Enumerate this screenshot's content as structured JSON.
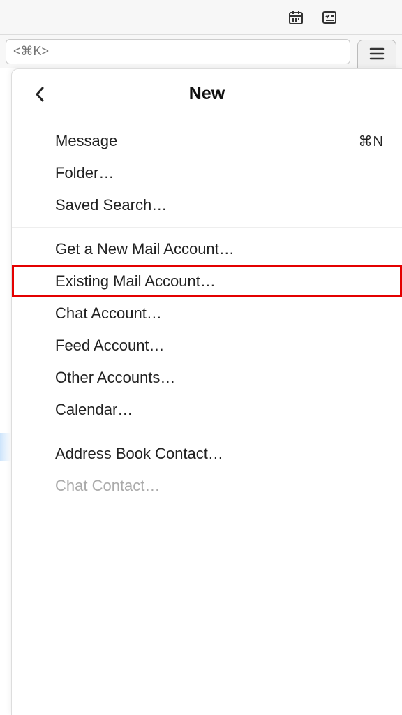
{
  "toolbar": {
    "calendar_icon": "calendar-icon",
    "tasks_icon": "tasks-icon"
  },
  "search": {
    "placeholder": "<⌘K>"
  },
  "menu": {
    "title": "New",
    "sections": [
      {
        "items": [
          {
            "label": "Message",
            "shortcut": "⌘N",
            "enabled": true,
            "highlighted": false
          },
          {
            "label": "Folder…",
            "shortcut": "",
            "enabled": true,
            "highlighted": false
          },
          {
            "label": "Saved Search…",
            "shortcut": "",
            "enabled": true,
            "highlighted": false
          }
        ]
      },
      {
        "items": [
          {
            "label": "Get a New Mail Account…",
            "shortcut": "",
            "enabled": true,
            "highlighted": false
          },
          {
            "label": "Existing Mail Account…",
            "shortcut": "",
            "enabled": true,
            "highlighted": true
          },
          {
            "label": "Chat Account…",
            "shortcut": "",
            "enabled": true,
            "highlighted": false
          },
          {
            "label": "Feed Account…",
            "shortcut": "",
            "enabled": true,
            "highlighted": false
          },
          {
            "label": "Other Accounts…",
            "shortcut": "",
            "enabled": true,
            "highlighted": false
          },
          {
            "label": "Calendar…",
            "shortcut": "",
            "enabled": true,
            "highlighted": false
          }
        ]
      },
      {
        "items": [
          {
            "label": "Address Book Contact…",
            "shortcut": "",
            "enabled": true,
            "highlighted": false
          },
          {
            "label": "Chat Contact…",
            "shortcut": "",
            "enabled": false,
            "highlighted": false
          }
        ]
      }
    ]
  }
}
